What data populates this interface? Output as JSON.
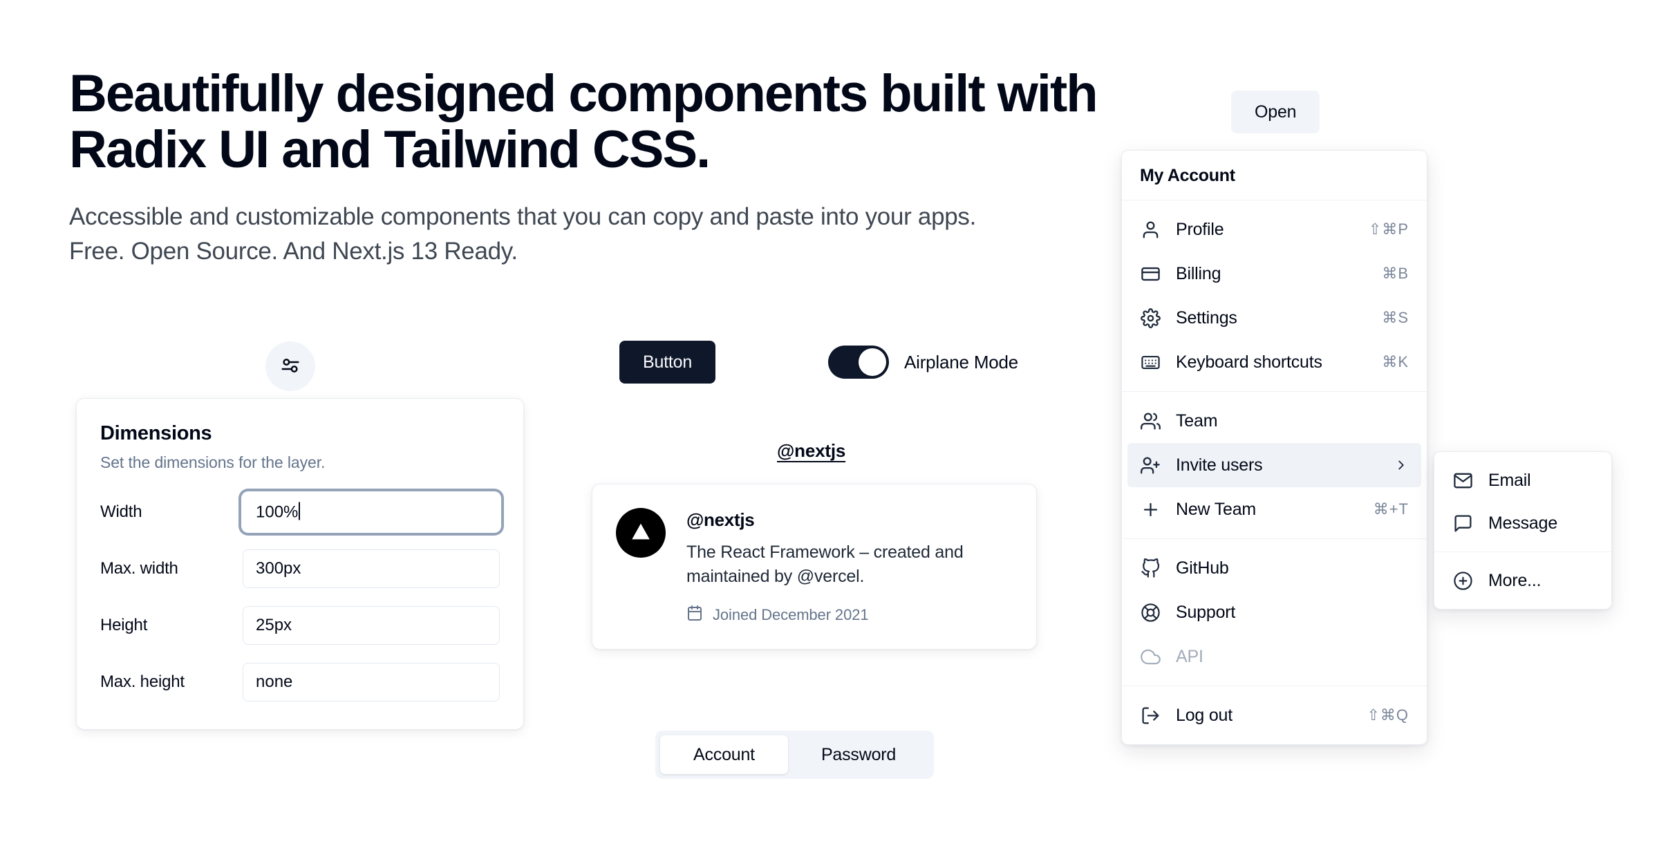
{
  "hero": {
    "heading": "Beautifully designed components built with Radix UI and Tailwind CSS.",
    "subheading": "Accessible and customizable components that you can copy and paste into your apps. Free. Open Source. And Next.js 13 Ready."
  },
  "popover": {
    "trigger_icon": "sliders-horizontal-icon",
    "title": "Dimensions",
    "description": "Set the dimensions for the layer.",
    "fields": [
      {
        "label": "Width",
        "value": "100%",
        "focused": true
      },
      {
        "label": "Max. width",
        "value": "300px",
        "focused": false
      },
      {
        "label": "Height",
        "value": "25px",
        "focused": false
      },
      {
        "label": "Max. height",
        "value": "none",
        "focused": false
      }
    ]
  },
  "button": {
    "label": "Button"
  },
  "switch": {
    "label": "Airplane Mode",
    "checked": true
  },
  "hovercard": {
    "trigger": "@nextjs",
    "avatar_icon": "vercel-triangle-icon",
    "handle": "@nextjs",
    "description": "The React Framework – created and maintained by @vercel.",
    "meta_icon": "calendar-icon",
    "meta": "Joined December 2021"
  },
  "tabs": {
    "items": [
      {
        "label": "Account",
        "active": true
      },
      {
        "label": "Password",
        "active": false
      }
    ]
  },
  "dropdown": {
    "trigger_label": "Open",
    "menu_label": "My Account",
    "groups": [
      {
        "items": [
          {
            "label": "Profile",
            "icon": "user-icon",
            "shortcut": "⇧⌘P",
            "highlighted": false,
            "disabled": false,
            "has_submenu": false
          },
          {
            "label": "Billing",
            "icon": "credit-card-icon",
            "shortcut": "⌘B",
            "highlighted": false,
            "disabled": false,
            "has_submenu": false
          },
          {
            "label": "Settings",
            "icon": "gear-icon",
            "shortcut": "⌘S",
            "highlighted": false,
            "disabled": false,
            "has_submenu": false
          },
          {
            "label": "Keyboard shortcuts",
            "icon": "keyboard-icon",
            "shortcut": "⌘K",
            "highlighted": false,
            "disabled": false,
            "has_submenu": false
          }
        ]
      },
      {
        "items": [
          {
            "label": "Team",
            "icon": "users-icon",
            "shortcut": "",
            "highlighted": false,
            "disabled": false,
            "has_submenu": false
          },
          {
            "label": "Invite users",
            "icon": "user-plus-icon",
            "shortcut": "",
            "highlighted": true,
            "disabled": false,
            "has_submenu": true
          },
          {
            "label": "New Team",
            "icon": "plus-icon",
            "shortcut": "⌘+T",
            "highlighted": false,
            "disabled": false,
            "has_submenu": false
          }
        ]
      },
      {
        "items": [
          {
            "label": "GitHub",
            "icon": "github-icon",
            "shortcut": "",
            "highlighted": false,
            "disabled": false,
            "has_submenu": false
          },
          {
            "label": "Support",
            "icon": "lifebuoy-icon",
            "shortcut": "",
            "highlighted": false,
            "disabled": false,
            "has_submenu": false
          },
          {
            "label": "API",
            "icon": "cloud-icon",
            "shortcut": "",
            "highlighted": false,
            "disabled": true,
            "has_submenu": false
          }
        ]
      },
      {
        "items": [
          {
            "label": "Log out",
            "icon": "logout-icon",
            "shortcut": "⇧⌘Q",
            "highlighted": false,
            "disabled": false,
            "has_submenu": false
          }
        ]
      }
    ],
    "submenu": {
      "groups": [
        {
          "items": [
            {
              "label": "Email",
              "icon": "mail-icon"
            },
            {
              "label": "Message",
              "icon": "message-square-icon"
            }
          ]
        },
        {
          "items": [
            {
              "label": "More...",
              "icon": "plus-circle-icon"
            }
          ]
        }
      ]
    }
  },
  "colors": {
    "foreground": "#020817",
    "muted_foreground": "#64748b",
    "accent": "#eff3f8",
    "primary": "#0f172a",
    "secondary": "#f1f5f9",
    "border": "#e2e8f0",
    "disabled": "#a2acba"
  }
}
